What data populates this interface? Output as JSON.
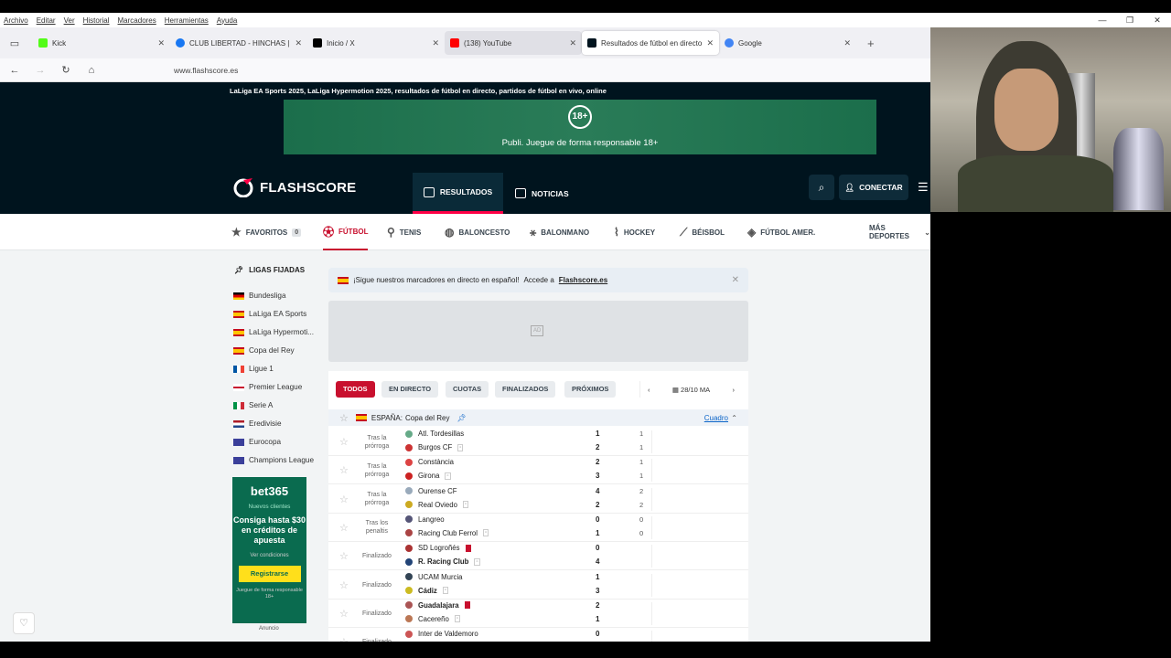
{
  "menubar": [
    "Archivo",
    "Editar",
    "Ver",
    "Historial",
    "Marcadores",
    "Herramientas",
    "Ayuda"
  ],
  "tabs": [
    {
      "title": "Kick",
      "icon_color": "#53fc18"
    },
    {
      "title": "CLUB LIBERTAD - HINCHAS | Fa",
      "icon_color": "#1877f2"
    },
    {
      "title": "Inicio / X",
      "icon_color": "#000000"
    },
    {
      "title": "(138) YouTube",
      "icon_color": "#ff0000"
    },
    {
      "title": "Resultados de fútbol en directo",
      "icon_color": "#00141e"
    },
    {
      "title": "Google",
      "icon_color": "#4285f4"
    }
  ],
  "url": "www.flashscore.es",
  "site": {
    "tagline": "LaLiga EA Sports 2025, LaLiga Hypermotion 2025, resultados de fútbol en directo, partidos de fútbol en vivo, online",
    "banner_age": "18+",
    "banner_text": "Publi. Juegue de forma responsable  18+",
    "logo": "FLASHSCORE",
    "nav_resultados": "RESULTADOS",
    "nav_noticias": "NOTICIAS",
    "login": "CONECTAR",
    "accent": "#c8102e"
  },
  "sports": [
    {
      "label": "FAVORITOS",
      "badge": "0"
    },
    {
      "label": "FÚTBOL"
    },
    {
      "label": "TENIS"
    },
    {
      "label": "BALONCESTO"
    },
    {
      "label": "BALONMANO"
    },
    {
      "label": "HOCKEY"
    },
    {
      "label": "BÉISBOL"
    },
    {
      "label": "FÚTBOL AMER."
    },
    {
      "label": "MÁS DEPORTES"
    }
  ],
  "pinned_title": "LIGAS FIJADAS",
  "leagues": [
    "Bundesliga",
    "LaLiga EA Sports",
    "LaLiga Hypermoti...",
    "Copa del Rey",
    "Ligue 1",
    "Premier League",
    "Serie A",
    "Eredivisie",
    "Eurocopa",
    "Champions League"
  ],
  "bet": {
    "brand": "bet365",
    "sub": "Nuevos clientes",
    "offer": "Consiga hasta $30 en créditos de apuesta",
    "cond": "Ver condiciones",
    "btn": "Registrarse",
    "legal": "Juegue de forma responsable 18+",
    "anuncio": "Anuncio"
  },
  "notice": {
    "text": "¡Sigue nuestros marcadores en directo en español!",
    "accede": "Accede a",
    "link": "Flashscore.es"
  },
  "ad_label": "AD",
  "filters": [
    "TODOS",
    "EN DIRECTO",
    "CUOTAS",
    "FINALIZADOS",
    "PRÓXIMOS"
  ],
  "date": "28/10 MA",
  "league_header": {
    "country": "ESPAÑA:",
    "name": "Copa del Rey",
    "cuadro": "Cuadro"
  },
  "matches": [
    {
      "status": "Tras la prórroga",
      "home": "Atl. Tordesillas",
      "away": "Burgos CF",
      "hs": "1",
      "as": "2",
      "hh": "1",
      "ah": "1"
    },
    {
      "status": "Tras la prórroga",
      "home": "Constància",
      "away": "Girona",
      "hs": "2",
      "as": "3",
      "hh": "1",
      "ah": "1"
    },
    {
      "status": "Tras la prórroga",
      "home": "Ourense CF",
      "away": "Real Oviedo",
      "hs": "4",
      "as": "2",
      "hh": "2",
      "ah": "2"
    },
    {
      "status": "Tras los penaltis",
      "home": "Langreo",
      "away": "Racing Club Ferrol",
      "hs": "0",
      "as": "1",
      "hh": "0",
      "ah": "0"
    },
    {
      "status": "Finalizado",
      "home": "SD Logroñés",
      "away": "R. Racing Club",
      "hs": "0",
      "as": "4",
      "hh": "",
      "ah": ""
    },
    {
      "status": "Finalizado",
      "home": "UCAM Murcia",
      "away": "Cádiz",
      "hs": "1",
      "as": "3",
      "hh": "",
      "ah": ""
    },
    {
      "status": "Finalizado",
      "home": "Guadalajara",
      "away": "Cacereño",
      "hs": "2",
      "as": "1",
      "hh": "",
      "ah": ""
    },
    {
      "status": "Finalizado",
      "home": "Inter de Valdemoro",
      "away": "",
      "hs": "0",
      "as": "",
      "hh": "",
      "ah": ""
    }
  ]
}
